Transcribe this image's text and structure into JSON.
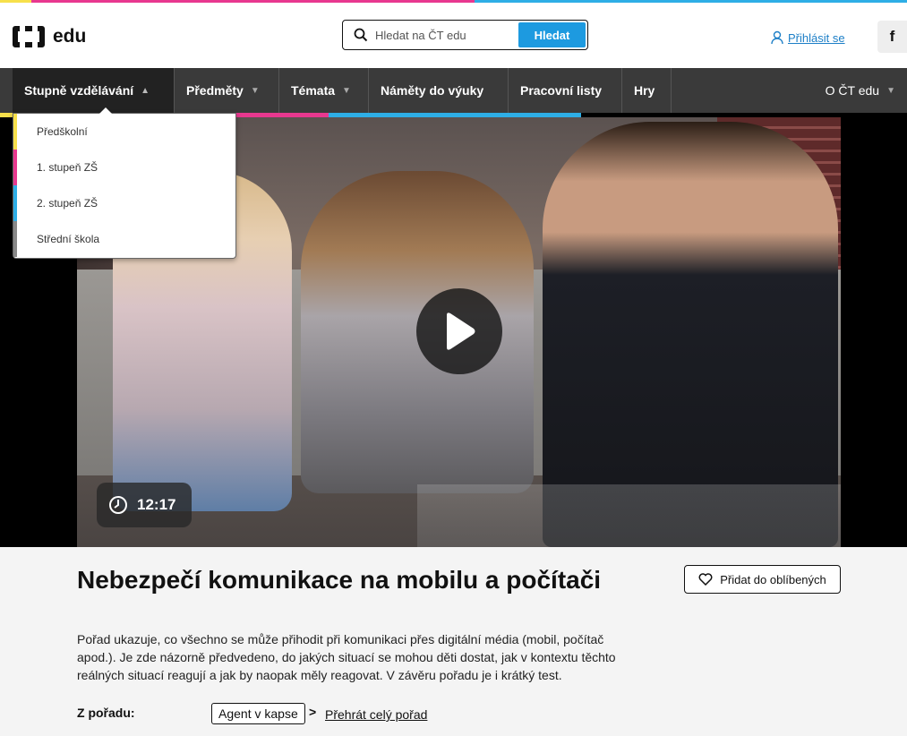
{
  "colors": {
    "pink": "#e8388f",
    "blue": "#2eaee6",
    "yellow": "#f7e04b",
    "gray": "#888888",
    "accent": "#1d9ae0"
  },
  "header": {
    "logo_text": "edu",
    "search": {
      "placeholder": "Hledat na ČT edu",
      "button": "Hledat"
    },
    "login": "Přihlásit se",
    "facebook_icon": "f"
  },
  "nav": {
    "items": [
      {
        "label": "Stupně vzdělávání",
        "has_caret": true
      },
      {
        "label": "Předměty",
        "has_caret": true
      },
      {
        "label": "Témata",
        "has_caret": true
      },
      {
        "label": "Náměty do výuky",
        "has_caret": false
      },
      {
        "label": "Pracovní listy",
        "has_caret": false
      },
      {
        "label": "Hry",
        "has_caret": false
      }
    ],
    "right": "O ČT edu"
  },
  "dropdown": {
    "items": [
      {
        "label": "Předškolní",
        "color": "#f7e04b"
      },
      {
        "label": "1. stupeň ZŠ",
        "color": "#e8388f"
      },
      {
        "label": "2. stupeň ZŠ",
        "color": "#2eaee6"
      },
      {
        "label": "Střední škola",
        "color": "#888888"
      }
    ]
  },
  "video": {
    "duration": "12:17"
  },
  "main": {
    "title": "Nebezpečí komunikace na mobilu a počítači",
    "description": "Pořad ukazuje, co všechno se může přihodit při komunikaci přes digitální média (mobil, počítač apod.). Je zde názorně předvedeno, do jakých situací se mohou děti dostat, jak v kontextu těchto reálných situací reagují a jak by naopak měly reagovat. V závěru pořadu je i krátký test.",
    "favorite_button": "Přidat do oblíbených",
    "from_label": "Z pořadu:",
    "show_name": "Agent v kapse",
    "chevron": ">",
    "play_all": "Přehrát celý pořad"
  }
}
